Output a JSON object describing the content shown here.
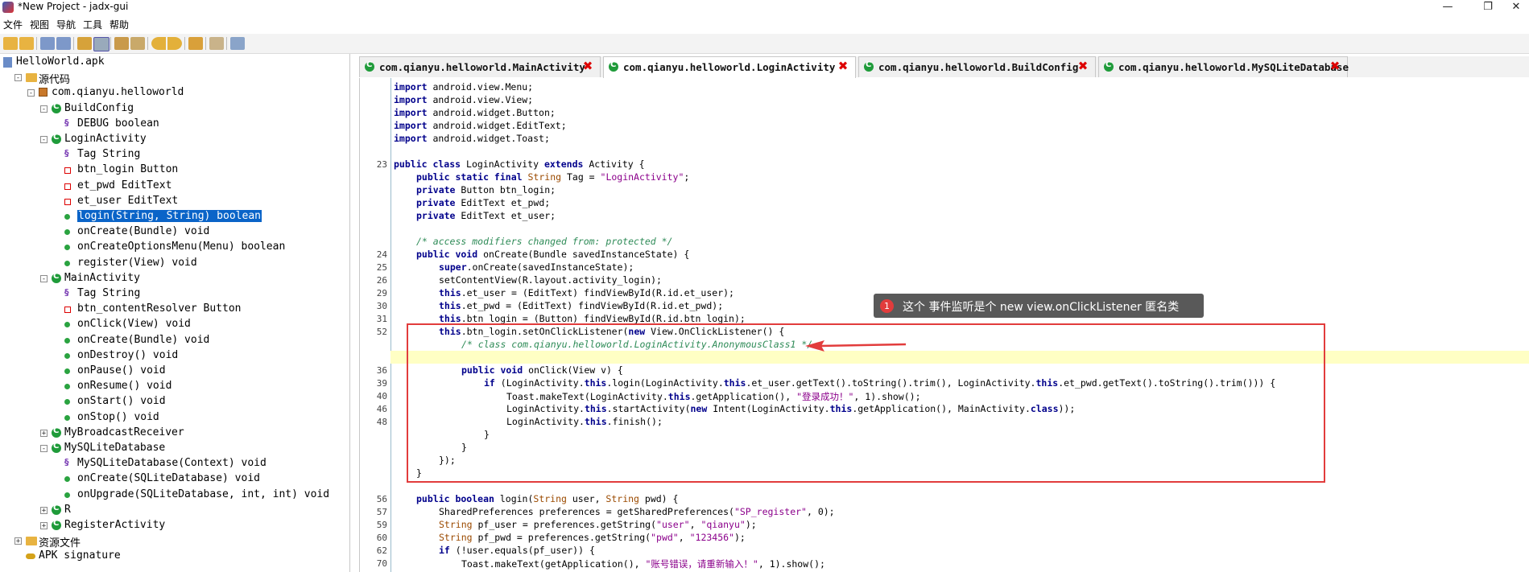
{
  "window": {
    "title": "*New Project - jadx-gui",
    "minimize": "—",
    "maximize": "❐",
    "close": "✕"
  },
  "menu": [
    "文件",
    "视图",
    "导航",
    "工具",
    "帮助"
  ],
  "toolbar_icons": [
    "open-icon",
    "save-icon",
    "copy-icon",
    "paste-icon",
    "sync-icon",
    "flatten-icon",
    "search-icon",
    "find-icon",
    "back-icon",
    "forward-icon",
    "deobf-icon",
    "log-icon",
    "prefs-icon"
  ],
  "tree": [
    {
      "label": "HelloWorld.apk",
      "indent": 0,
      "icon": "file",
      "expander": ""
    },
    {
      "label": "源代码",
      "indent": 1,
      "icon": "folder",
      "expander": "-"
    },
    {
      "label": "com.qianyu.helloworld",
      "indent": 2,
      "icon": "package",
      "expander": "-"
    },
    {
      "label": "BuildConfig",
      "indent": 3,
      "icon": "class",
      "expander": "-"
    },
    {
      "label": "DEBUG boolean",
      "indent": 4,
      "icon": "static"
    },
    {
      "label": "LoginActivity",
      "indent": 3,
      "icon": "class",
      "expander": "-"
    },
    {
      "label": "Tag String",
      "indent": 4,
      "icon": "static"
    },
    {
      "label": "btn_login Button",
      "indent": 4,
      "icon": "field"
    },
    {
      "label": "et_pwd EditText",
      "indent": 4,
      "icon": "field"
    },
    {
      "label": "et_user EditText",
      "indent": 4,
      "icon": "field"
    },
    {
      "label": "login(String, String) boolean",
      "indent": 4,
      "icon": "method",
      "selected": true
    },
    {
      "label": "onCreate(Bundle) void",
      "indent": 4,
      "icon": "method"
    },
    {
      "label": "onCreateOptionsMenu(Menu) boolean",
      "indent": 4,
      "icon": "method"
    },
    {
      "label": "register(View) void",
      "indent": 4,
      "icon": "method"
    },
    {
      "label": "MainActivity",
      "indent": 3,
      "icon": "class",
      "expander": "-"
    },
    {
      "label": "Tag String",
      "indent": 4,
      "icon": "static"
    },
    {
      "label": "btn_contentResolver Button",
      "indent": 4,
      "icon": "field"
    },
    {
      "label": "onClick(View) void",
      "indent": 4,
      "icon": "method"
    },
    {
      "label": "onCreate(Bundle) void",
      "indent": 4,
      "icon": "method"
    },
    {
      "label": "onDestroy() void",
      "indent": 4,
      "icon": "method"
    },
    {
      "label": "onPause() void",
      "indent": 4,
      "icon": "method"
    },
    {
      "label": "onResume() void",
      "indent": 4,
      "icon": "method"
    },
    {
      "label": "onStart() void",
      "indent": 4,
      "icon": "method"
    },
    {
      "label": "onStop() void",
      "indent": 4,
      "icon": "method"
    },
    {
      "label": "MyBroadcastReceiver",
      "indent": 3,
      "icon": "class",
      "expander": "+"
    },
    {
      "label": "MySQLiteDatabase",
      "indent": 3,
      "icon": "class",
      "expander": "-"
    },
    {
      "label": "MySQLiteDatabase(Context) void",
      "indent": 4,
      "icon": "static"
    },
    {
      "label": "onCreate(SQLiteDatabase) void",
      "indent": 4,
      "icon": "method"
    },
    {
      "label": "onUpgrade(SQLiteDatabase, int, int) void",
      "indent": 4,
      "icon": "method"
    },
    {
      "label": "R",
      "indent": 3,
      "icon": "class",
      "expander": "+"
    },
    {
      "label": "RegisterActivity",
      "indent": 3,
      "icon": "class",
      "expander": "+"
    },
    {
      "label": "资源文件",
      "indent": 1,
      "icon": "folder",
      "expander": "+"
    },
    {
      "label": "APK signature",
      "indent": 1,
      "icon": "key"
    }
  ],
  "tabs": [
    {
      "label": "com.qianyu.helloworld.MainActivity",
      "active": false
    },
    {
      "label": "com.qianyu.helloworld.LoginActivity",
      "active": true
    },
    {
      "label": "com.qianyu.helloworld.BuildConfig",
      "active": false
    },
    {
      "label": "com.qianyu.helloworld.MySQLiteDatabase",
      "active": false
    }
  ],
  "code_lines": [
    {
      "n": "",
      "indent": 0,
      "html": "<span class='kw'>import</span> android.view.Menu;"
    },
    {
      "n": "",
      "indent": 0,
      "html": "<span class='kw'>import</span> android.view.View;"
    },
    {
      "n": "",
      "indent": 0,
      "html": "<span class='kw'>import</span> android.widget.Button;"
    },
    {
      "n": "",
      "indent": 0,
      "html": "<span class='kw'>import</span> android.widget.EditText;"
    },
    {
      "n": "",
      "indent": 0,
      "html": "<span class='kw'>import</span> android.widget.Toast;"
    },
    {
      "n": "",
      "indent": 0,
      "html": ""
    },
    {
      "n": "23",
      "indent": 0,
      "html": "<span class='kw'>public class</span> LoginActivity <span class='kw'>extends</span> Activity {"
    },
    {
      "n": "",
      "indent": 1,
      "html": "<span class='kw'>public static final</span> <span class='ty'>String</span> Tag = <span class='str'>\"LoginActivity\"</span>;"
    },
    {
      "n": "",
      "indent": 1,
      "html": "<span class='kw'>private</span> Button btn_login;"
    },
    {
      "n": "",
      "indent": 1,
      "html": "<span class='kw'>private</span> EditText et_pwd;"
    },
    {
      "n": "",
      "indent": 1,
      "html": "<span class='kw'>private</span> EditText et_user;"
    },
    {
      "n": "",
      "indent": 0,
      "html": ""
    },
    {
      "n": "",
      "indent": 1,
      "html": "<span class='cm'>/* access modifiers changed from: protected */</span>"
    },
    {
      "n": "24",
      "indent": 1,
      "html": "<span class='kw'>public void</span> onCreate(Bundle savedInstanceState) {"
    },
    {
      "n": "25",
      "indent": 2,
      "html": "<span class='kw'>super</span>.onCreate(savedInstanceState);"
    },
    {
      "n": "26",
      "indent": 2,
      "html": "setContentView(R.layout.activity_login);"
    },
    {
      "n": "29",
      "indent": 2,
      "html": "<span class='kw'>this</span>.et_user = (EditText) findViewById(R.id.et_user);"
    },
    {
      "n": "30",
      "indent": 2,
      "html": "<span class='kw'>this</span>.et_pwd = (EditText) findViewById(R.id.et_pwd);"
    },
    {
      "n": "31",
      "indent": 2,
      "html": "<span class='kw'>this</span>.btn_login = (Button) findViewById(R.id.btn_login);"
    },
    {
      "n": "52",
      "indent": 2,
      "html": "<span class='kw'>this</span>.btn_login.setOnClickListener(<span class='kw'>new</span> View.OnClickListener() {"
    },
    {
      "n": "",
      "indent": 3,
      "html": "<span class='cm'>/* class com.qianyu.helloworld.LoginActivity.AnonymousClass1 */</span>"
    },
    {
      "n": "",
      "indent": 0,
      "html": "",
      "highlight": true
    },
    {
      "n": "36",
      "indent": 3,
      "html": "<span class='kw'>public void</span> onClick(View v) {"
    },
    {
      "n": "39",
      "indent": 4,
      "html": "<span class='kw'>if</span> (LoginActivity.<span class='kw'>this</span>.login(LoginActivity.<span class='kw'>this</span>.et_user.getText().toString().trim(), LoginActivity.<span class='kw'>this</span>.et_pwd.getText().toString().trim())) {"
    },
    {
      "n": "40",
      "indent": 5,
      "html": "Toast.makeText(LoginActivity.<span class='kw'>this</span>.getApplication(), <span class='str'>\"登录成功！\"</span>, 1).show();"
    },
    {
      "n": "46",
      "indent": 5,
      "html": "LoginActivity.<span class='kw'>this</span>.startActivity(<span class='kw'>new</span> Intent(LoginActivity.<span class='kw'>this</span>.getApplication(), MainActivity.<span class='kw'>class</span>));"
    },
    {
      "n": "48",
      "indent": 5,
      "html": "LoginActivity.<span class='kw'>this</span>.finish();"
    },
    {
      "n": "",
      "indent": 4,
      "html": "}"
    },
    {
      "n": "",
      "indent": 3,
      "html": "}"
    },
    {
      "n": "",
      "indent": 2,
      "html": "});"
    },
    {
      "n": "",
      "indent": 1,
      "html": "}"
    },
    {
      "n": "",
      "indent": 0,
      "html": ""
    },
    {
      "n": "56",
      "indent": 1,
      "html": "<span class='kw'>public boolean</span> login(<span class='ty'>String</span> user, <span class='ty'>String</span> pwd) {"
    },
    {
      "n": "57",
      "indent": 2,
      "html": "SharedPreferences preferences = getSharedPreferences(<span class='str'>\"SP_register\"</span>, 0);"
    },
    {
      "n": "59",
      "indent": 2,
      "html": "<span class='ty'>String</span> pf_user = preferences.getString(<span class='str'>\"user\"</span>, <span class='str'>\"qianyu\"</span>);"
    },
    {
      "n": "60",
      "indent": 2,
      "html": "<span class='ty'>String</span> pf_pwd = preferences.getString(<span class='str'>\"pwd\"</span>, <span class='str'>\"123456\"</span>);"
    },
    {
      "n": "62",
      "indent": 2,
      "html": "<span class='kw'>if</span> (!user.equals(pf_user)) {"
    },
    {
      "n": "70",
      "indent": 3,
      "html": "Toast.makeText(getApplication(), <span class='str'>\"账号错误，请重新输入！\"</span>, 1).show();"
    }
  ],
  "annotation": {
    "number": "1",
    "text": "这个 事件监听是个  new view.onClickListener 匿名类"
  }
}
